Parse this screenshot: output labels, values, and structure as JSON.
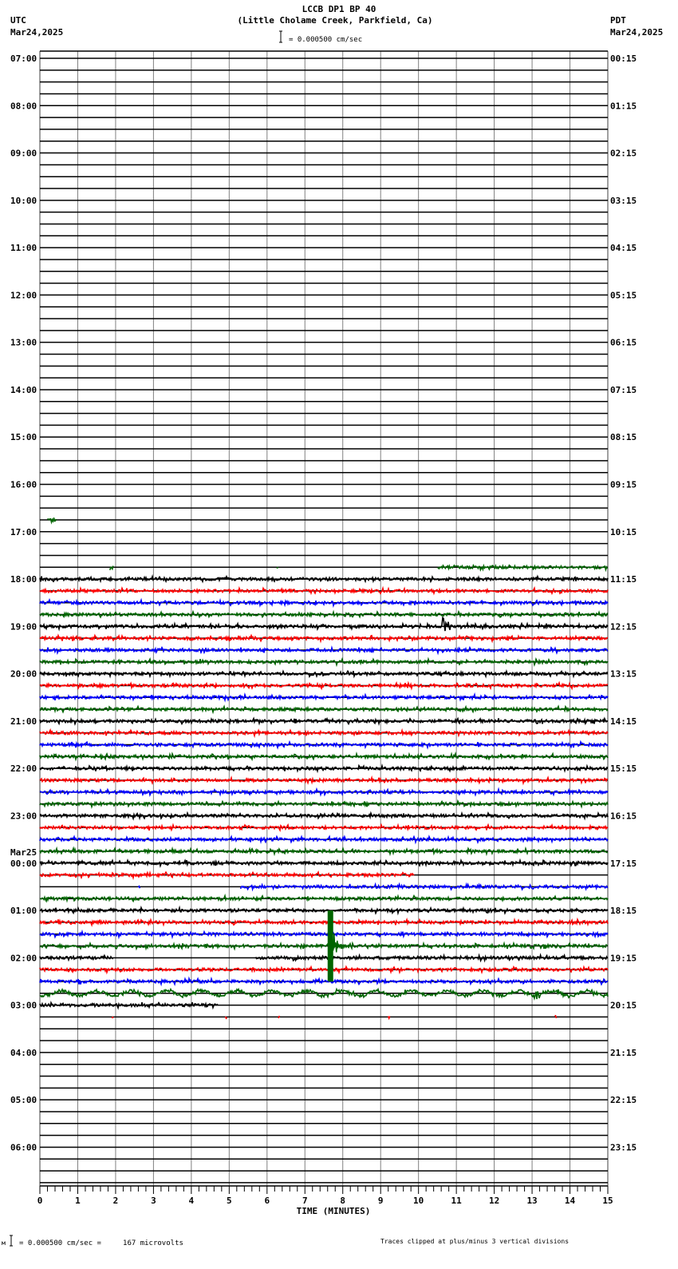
{
  "header": {
    "title": "LCCB DP1 BP 40",
    "subtitle": "(Little Cholame Creek, Parkfield, Ca)",
    "left_tz": "UTC",
    "left_date": "Mar24,2025",
    "right_tz": "PDT",
    "right_date": "Mar24,2025",
    "scale_text": "= 0.000500 cm/sec"
  },
  "footer": {
    "scale_prefix": "м",
    "scale_text": "= 0.000500 cm/sec =     167 microvolts",
    "clip_note": "Traces clipped at plus/minus 3 vertical divisions"
  },
  "chart_data": {
    "type": "line",
    "title": "LCCB DP1 BP 40",
    "xlabel": "TIME (MINUTES)",
    "xlim": [
      0,
      15
    ],
    "x_ticks": [
      "0",
      "1",
      "2",
      "3",
      "4",
      "5",
      "6",
      "7",
      "8",
      "9",
      "10",
      "11",
      "12",
      "13",
      "14",
      "15"
    ],
    "minor_ticks_per_minute": 5,
    "rows_total": 96,
    "rows_per_hour": 4,
    "utc_labels": [
      "07:00",
      "08:00",
      "09:00",
      "10:00",
      "11:00",
      "12:00",
      "13:00",
      "14:00",
      "15:00",
      "16:00",
      "17:00",
      "18:00",
      "19:00",
      "20:00",
      "21:00",
      "22:00",
      "23:00",
      "00:00",
      "01:00",
      "02:00",
      "03:00",
      "04:00",
      "05:00",
      "06:00"
    ],
    "date_change_label": {
      "hour_index": 17,
      "text": "Mar25"
    },
    "pdt_labels": [
      "00:15",
      "01:15",
      "02:15",
      "03:15",
      "04:15",
      "05:15",
      "06:15",
      "07:15",
      "08:15",
      "09:15",
      "10:15",
      "11:15",
      "12:15",
      "13:15",
      "14:15",
      "15:15",
      "16:15",
      "17:15",
      "18:15",
      "19:15",
      "20:15",
      "21:15",
      "22:15",
      "23:15"
    ],
    "trace_colors": [
      "#000000",
      "#ff0000",
      "#0000ff",
      "#006400"
    ],
    "grid_color": "#808080",
    "noise_amplitude_div": 0.12,
    "full_rows": [
      44,
      79
    ],
    "segments": [
      {
        "row": 39,
        "from": 0.2,
        "to": 0.45
      },
      {
        "row": 43,
        "from": 10.5,
        "to": 15
      },
      {
        "row": 43,
        "from": 1.85,
        "to": 1.95
      },
      {
        "row": 43,
        "from": 6.25,
        "to": 6.3
      },
      {
        "row": 70,
        "from": 2.6,
        "to": 2.65
      },
      {
        "row": 80,
        "from": 0,
        "to": 4.7
      },
      {
        "row": 81,
        "from": 1.9,
        "to": 1.95
      },
      {
        "row": 81,
        "from": 4.9,
        "to": 4.95
      },
      {
        "row": 81,
        "from": 6.3,
        "to": 6.35
      },
      {
        "row": 81,
        "from": 9.2,
        "to": 9.25
      },
      {
        "row": 81,
        "from": 13.6,
        "to": 13.65
      }
    ],
    "row_overrides": [
      {
        "row": 69,
        "from": 0,
        "to": 9.9
      },
      {
        "row": 70,
        "from": 5.3,
        "to": 15
      },
      {
        "row": 76,
        "from": 0,
        "to": 1.95
      },
      {
        "row": 76,
        "from": 5.7,
        "to": 15
      }
    ],
    "wavy_rows": [
      79
    ],
    "events": [
      {
        "row": 48,
        "minute": 10.6,
        "amplitude_div": 1.5,
        "duration_min": 0.3
      },
      {
        "row": 75,
        "minute": 7.6,
        "amplitude_div": 3,
        "duration_min": 0.6,
        "clipped": true
      },
      {
        "row": 79,
        "minute": 13.1,
        "amplitude_div": 0.5,
        "duration_min": 0.3
      }
    ]
  }
}
